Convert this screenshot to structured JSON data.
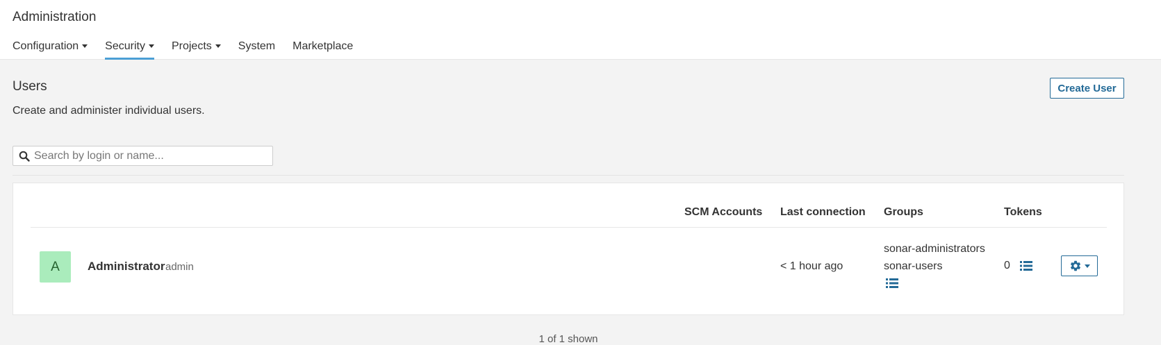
{
  "header": {
    "title": "Administration",
    "nav": [
      {
        "label": "Configuration",
        "has_dropdown": true,
        "active": false
      },
      {
        "label": "Security",
        "has_dropdown": true,
        "active": true
      },
      {
        "label": "Projects",
        "has_dropdown": true,
        "active": false
      },
      {
        "label": "System",
        "has_dropdown": false,
        "active": false
      },
      {
        "label": "Marketplace",
        "has_dropdown": false,
        "active": false
      }
    ]
  },
  "page": {
    "title": "Users",
    "description": "Create and administer individual users.",
    "create_button": "Create User"
  },
  "search": {
    "placeholder": "Search by login or name...",
    "value": "",
    "icon": "search-icon"
  },
  "table": {
    "columns": {
      "scm_accounts": "SCM Accounts",
      "last_connection": "Last connection",
      "groups": "Groups",
      "tokens": "Tokens"
    },
    "rows": [
      {
        "avatar_letter": "A",
        "name": "Administrator",
        "login": "admin",
        "scm_accounts": "",
        "last_connection": "< 1 hour ago",
        "groups": [
          "sonar-administrators",
          "sonar-users"
        ],
        "tokens": "0"
      }
    ]
  },
  "footer": {
    "count_text": "1 of 1 shown"
  },
  "colors": {
    "accent": "#4b9fd5",
    "button_blue": "#236a97",
    "avatar_bg": "#aaecbc",
    "page_bg": "#f3f3f3"
  },
  "icons": {
    "groups_edit": "bulleted-list-icon",
    "tokens_edit": "bulleted-list-icon",
    "actions": "gear-icon"
  }
}
